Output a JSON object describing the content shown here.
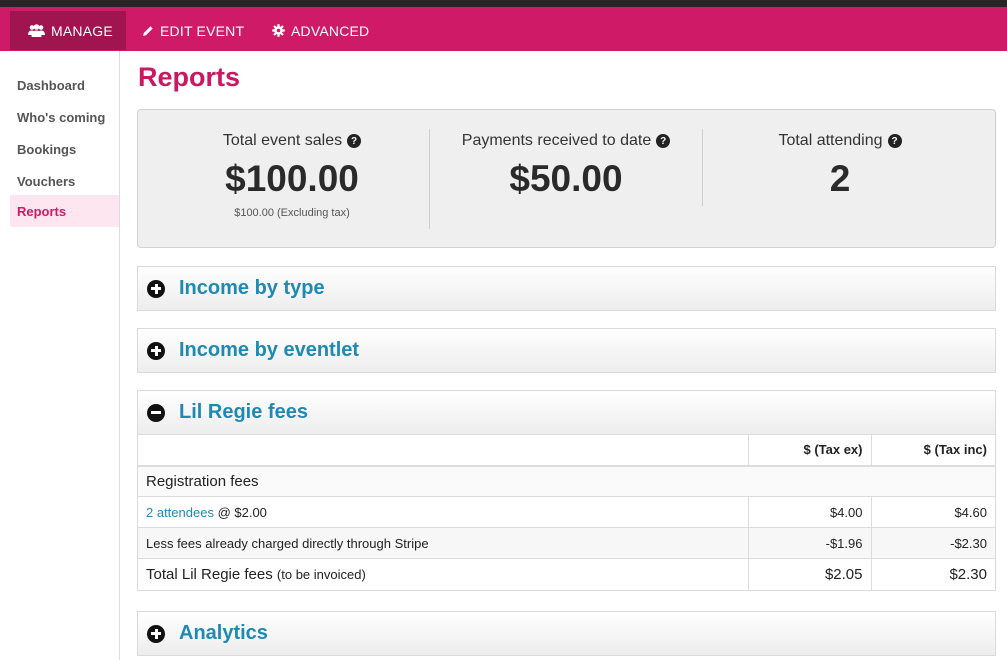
{
  "topnav": {
    "tabs": [
      {
        "label": "MANAGE",
        "icon": "users-icon"
      },
      {
        "label": "EDIT EVENT",
        "icon": "pencil-icon"
      },
      {
        "label": "ADVANCED",
        "icon": "gear-icon"
      }
    ],
    "accent_color": "#cf1a67"
  },
  "sidebar": {
    "items": [
      {
        "label": "Dashboard"
      },
      {
        "label": "Who's coming"
      },
      {
        "label": "Bookings"
      },
      {
        "label": "Vouchers"
      },
      {
        "label": "Reports"
      }
    ]
  },
  "page": {
    "title": "Reports"
  },
  "summary": {
    "total_sales": {
      "label": "Total event sales",
      "value": "$100.00",
      "sub": "$100.00 (Excluding tax)"
    },
    "payments": {
      "label": "Payments received to date",
      "value": "$50.00"
    },
    "attending": {
      "label": "Total attending",
      "value": "2"
    },
    "help_glyph": "?"
  },
  "panels": {
    "income_type": {
      "title": "Income by type"
    },
    "income_eventlet": {
      "title": "Income by eventlet"
    },
    "fees": {
      "title": "Lil Regie fees",
      "headers": [
        "",
        "$ (Tax ex)",
        "$ (Tax inc)"
      ],
      "group_label": "Registration fees",
      "attendee_link": "2 attendees",
      "attendee_rate": " @ $2.00",
      "attendee_tax_ex": "$4.00",
      "attendee_tax_inc": "$4.60",
      "stripe_label": "Less fees already charged directly through Stripe",
      "stripe_tax_ex": "-$1.96",
      "stripe_tax_inc": "-$2.30",
      "total_label": "Total Lil Regie fees",
      "total_note": "(to be invoiced)",
      "total_tax_ex": "$2.05",
      "total_tax_inc": "$2.30"
    },
    "analytics": {
      "title": "Analytics"
    }
  }
}
